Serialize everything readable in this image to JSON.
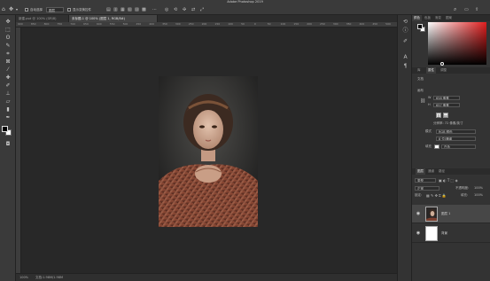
{
  "app": {
    "title": "Adobe Photoshop 2019"
  },
  "options_bar": {
    "auto_select_label": "自动选择",
    "auto_select_target": "图层",
    "transform_controls_label": "显示变换控件"
  },
  "document_tabs": [
    {
      "label": "新建.psd @ 100% (GR/8)"
    },
    {
      "label": "未标题-1 @ 100% (图层 1, RGB/8#)"
    }
  ],
  "ruler": {
    "ticks": [
      "900",
      "850",
      "800",
      "750",
      "700",
      "650",
      "600",
      "550",
      "500",
      "450",
      "400",
      "350",
      "300",
      "250",
      "200",
      "150",
      "100",
      "50",
      "0",
      "50",
      "100",
      "150",
      "200",
      "250",
      "300",
      "350",
      "400",
      "450",
      "500"
    ]
  },
  "status_bar": {
    "zoom": "100%",
    "doc_info": "文档:1.98M/1.98M"
  },
  "panels": {
    "color_tabs": [
      "颜色",
      "色板",
      "渐变",
      "图案"
    ],
    "properties_tabs": [
      "库",
      "属性",
      "调整"
    ],
    "properties": {
      "section_doc": "文档",
      "section_canvas": "画布",
      "width_label": "W",
      "width_value": "658 像素",
      "height_label": "H",
      "height_value": "657 像素",
      "resolution": "分辨率: 72 像素/英寸",
      "mode_label": "模式",
      "mode_value": "RGB 颜色",
      "depth_value": "8 位/通道",
      "fill_label": "填充",
      "fill_value": "白色"
    },
    "layers_tabs": [
      "图层",
      "通道",
      "路径"
    ],
    "layers_controls": {
      "kind_label": "类型",
      "blend_mode": "正常",
      "opacity_label": "不透明度:",
      "opacity_value": "100%",
      "lock_label": "锁定:",
      "fill_label": "填充:",
      "fill_value": "100%"
    },
    "layers": [
      {
        "name": "图层 1",
        "selected": true
      },
      {
        "name": "背景",
        "selected": false
      }
    ]
  },
  "colors": {
    "ui_dark": "#282828",
    "panel": "#333333",
    "foreground": "#000000",
    "background": "#ffffff",
    "picker_hue": "#e01e1e"
  }
}
